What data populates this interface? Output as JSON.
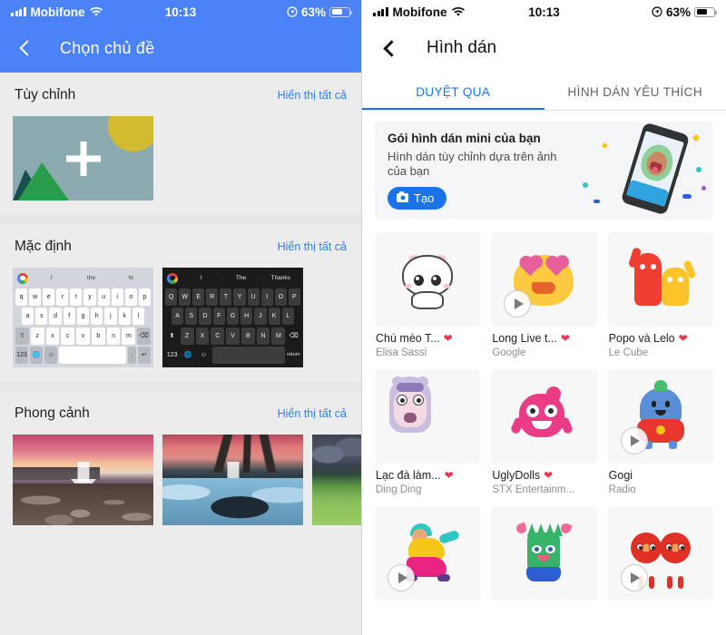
{
  "status_bar": {
    "carrier": "Mobifone",
    "time": "10:13",
    "battery_percent": "63%",
    "wifi_icon": "wifi-icon",
    "signal_icon": "signal-bars-icon",
    "battery_icon": "battery-icon",
    "location_icon": "location-arrow-icon"
  },
  "left_screen": {
    "header": {
      "title": "Chọn chủ đề",
      "back_icon": "chevron-left-icon"
    },
    "sections": [
      {
        "title": "Tùy chỉnh",
        "link": "Hiển thị tất cả"
      },
      {
        "title": "Mặc định",
        "link": "Hiển thị tất cả"
      },
      {
        "title": "Phong cảnh",
        "link": "Hiển thị tất cả"
      }
    ],
    "custom_tile": {
      "label": "add-custom-theme",
      "plus_icon": "plus-icon"
    },
    "keyboards": [
      {
        "name": "light-keyboard-theme",
        "suggestions": [
          "I",
          "the",
          "hi"
        ],
        "row1": [
          "q",
          "w",
          "e",
          "r",
          "t",
          "y",
          "u",
          "i",
          "o",
          "p"
        ],
        "row2": [
          "a",
          "s",
          "d",
          "f",
          "g",
          "h",
          "j",
          "k",
          "l"
        ],
        "row3": [
          "z",
          "x",
          "c",
          "v",
          "b",
          "n",
          "m"
        ],
        "shift": "⇧",
        "backspace": "⌫",
        "numbers": "123",
        "globe": "🌐",
        "emoji": "☺",
        "period": ".",
        "enter": "↵"
      },
      {
        "name": "dark-keyboard-theme",
        "suggestions": [
          "I",
          "The",
          "Thanks"
        ],
        "row1": [
          "Q",
          "W",
          "E",
          "R",
          "T",
          "Y",
          "U",
          "I",
          "O",
          "P"
        ],
        "row2": [
          "A",
          "S",
          "D",
          "F",
          "G",
          "H",
          "J",
          "K",
          "L"
        ],
        "row3": [
          "Z",
          "X",
          "C",
          "V",
          "B",
          "N",
          "M"
        ],
        "shift": "⬆",
        "backspace": "⌫",
        "numbers": "123",
        "globe": "🌐",
        "emoji": "☺",
        "enter": "return"
      }
    ],
    "scenic": [
      {
        "name": "scenic-theme-beach-sunset",
        "download_icon": "download-arrow-icon"
      },
      {
        "name": "scenic-theme-icy-river",
        "download_icon": "download-arrow-icon"
      },
      {
        "name": "scenic-theme-green-hills",
        "download_icon": "download-arrow-icon"
      }
    ]
  },
  "right_screen": {
    "header": {
      "title": "Hình dán",
      "back_icon": "chevron-left-icon"
    },
    "tabs": [
      {
        "label": "DUYỆT QUA",
        "active": true
      },
      {
        "label": "HÌNH DÁN YÊU THÍCH",
        "active": false
      }
    ],
    "promo": {
      "title": "Gói hình dán mini của bạn",
      "subtitle": "Hình dán tùy chỉnh dựa trên ảnh của bạn",
      "button": "Tạo",
      "button_icon": "camera-icon",
      "art": "phone-selfie-confetti-illustration"
    },
    "stickers": [
      {
        "name": "Chú mèo T...",
        "author": "Elisa Sassi",
        "favorite": true,
        "has_play": false,
        "art": "cat"
      },
      {
        "name": "Long Live t...",
        "author": "Google",
        "favorite": true,
        "has_play": true,
        "art": "emoji"
      },
      {
        "name": "Popo và Lelo",
        "author": "Le Cube",
        "favorite": true,
        "has_play": false,
        "art": "popo"
      },
      {
        "name": "Lạc đà làm...",
        "author": "Ding Ding",
        "favorite": true,
        "has_play": false,
        "art": "camel"
      },
      {
        "name": "UglyDolls",
        "author": "STX Entertainm...",
        "favorite": true,
        "has_play": false,
        "art": "ugly"
      },
      {
        "name": "Gogi",
        "author": "Radio",
        "favorite": false,
        "has_play": true,
        "art": "gogi"
      },
      {
        "name": "",
        "author": "",
        "favorite": false,
        "has_play": true,
        "art": "dancer"
      },
      {
        "name": "",
        "author": "",
        "favorite": false,
        "has_play": false,
        "art": "cactus"
      },
      {
        "name": "",
        "author": "",
        "favorite": false,
        "has_play": true,
        "art": "tomato"
      }
    ],
    "heart_icon": "heart-filled-icon",
    "play_icon": "play-circle-icon"
  },
  "colors": {
    "blue_header": "#4c82f7",
    "tab_active": "#1a73e8",
    "link": "#2f7fe8",
    "heart": "#e8384f",
    "left_bg": "#ececec"
  }
}
